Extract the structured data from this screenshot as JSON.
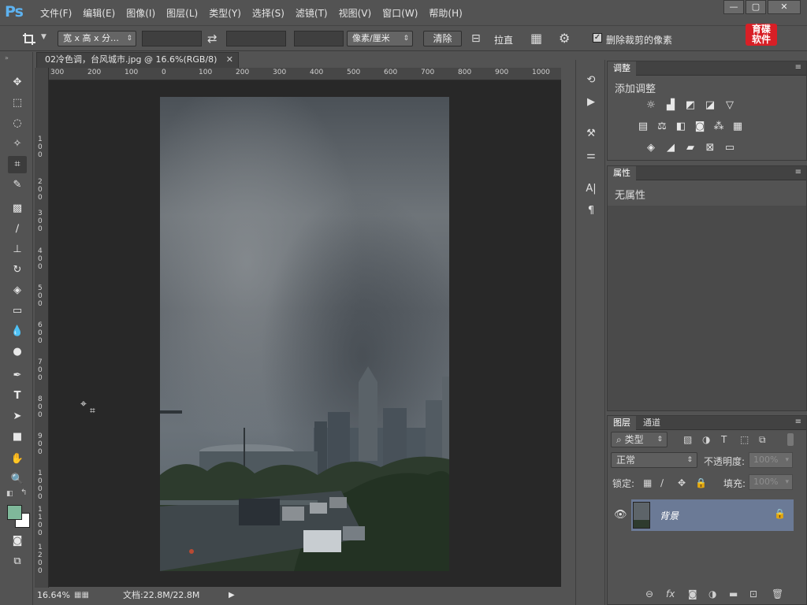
{
  "app": {
    "logo": "Ps"
  },
  "menu": [
    "文件(F)",
    "编辑(E)",
    "图像(I)",
    "图层(L)",
    "类型(Y)",
    "选择(S)",
    "滤镜(T)",
    "视图(V)",
    "窗口(W)",
    "帮助(H)"
  ],
  "window_controls": {
    "minimize": "—",
    "restore": "▢",
    "close": "✕"
  },
  "options": {
    "tool_icon": "crop-icon",
    "ratio_dropdown": "宽 x 高 x 分…",
    "unit_dropdown": "像素/厘米",
    "clear_button": "清除",
    "straighten_label": "拉直",
    "delete_cropped_label": "删除裁剪的像素",
    "delete_cropped_checked": true
  },
  "brand": {
    "line1": "育碟",
    "line2": "软件"
  },
  "document": {
    "tab_title": "02冷色调，台风城市.jpg @ 16.6%(RGB/8)",
    "zoom": "16.64%",
    "doc_size": "文档:22.8M/22.8M",
    "ruler_top": [
      "300",
      "200",
      "100",
      "0",
      "100",
      "200",
      "300",
      "400",
      "500",
      "600",
      "700",
      "800",
      "900",
      "1000"
    ],
    "ruler_left": [
      "1\n0\n0",
      "2\n0\n0",
      "3\n0\n0",
      "4\n0\n0",
      "5\n0\n0",
      "6\n0\n0",
      "7\n0\n0",
      "8\n0\n0",
      "9\n0\n0",
      "1\n0\n0\n0",
      "1\n1\n0\n0",
      "1\n2\n0\n0"
    ]
  },
  "adjustments_panel": {
    "tab": "调整",
    "title": "添加调整"
  },
  "properties_panel": {
    "tab": "属性",
    "content": "无属性"
  },
  "layers_panel": {
    "tabs": [
      "图层",
      "通道"
    ],
    "filter_kind": "类型",
    "blend_mode": "正常",
    "opacity_label": "不透明度:",
    "opacity_value": "100%",
    "lock_label": "锁定:",
    "fill_label": "填充:",
    "fill_value": "100%",
    "layers": [
      {
        "name": "背景",
        "visible": true,
        "locked": true
      }
    ]
  },
  "colors": {
    "foreground": "#7fb89a",
    "background": "#ffffff",
    "layer_selected": "#6b7a96"
  }
}
